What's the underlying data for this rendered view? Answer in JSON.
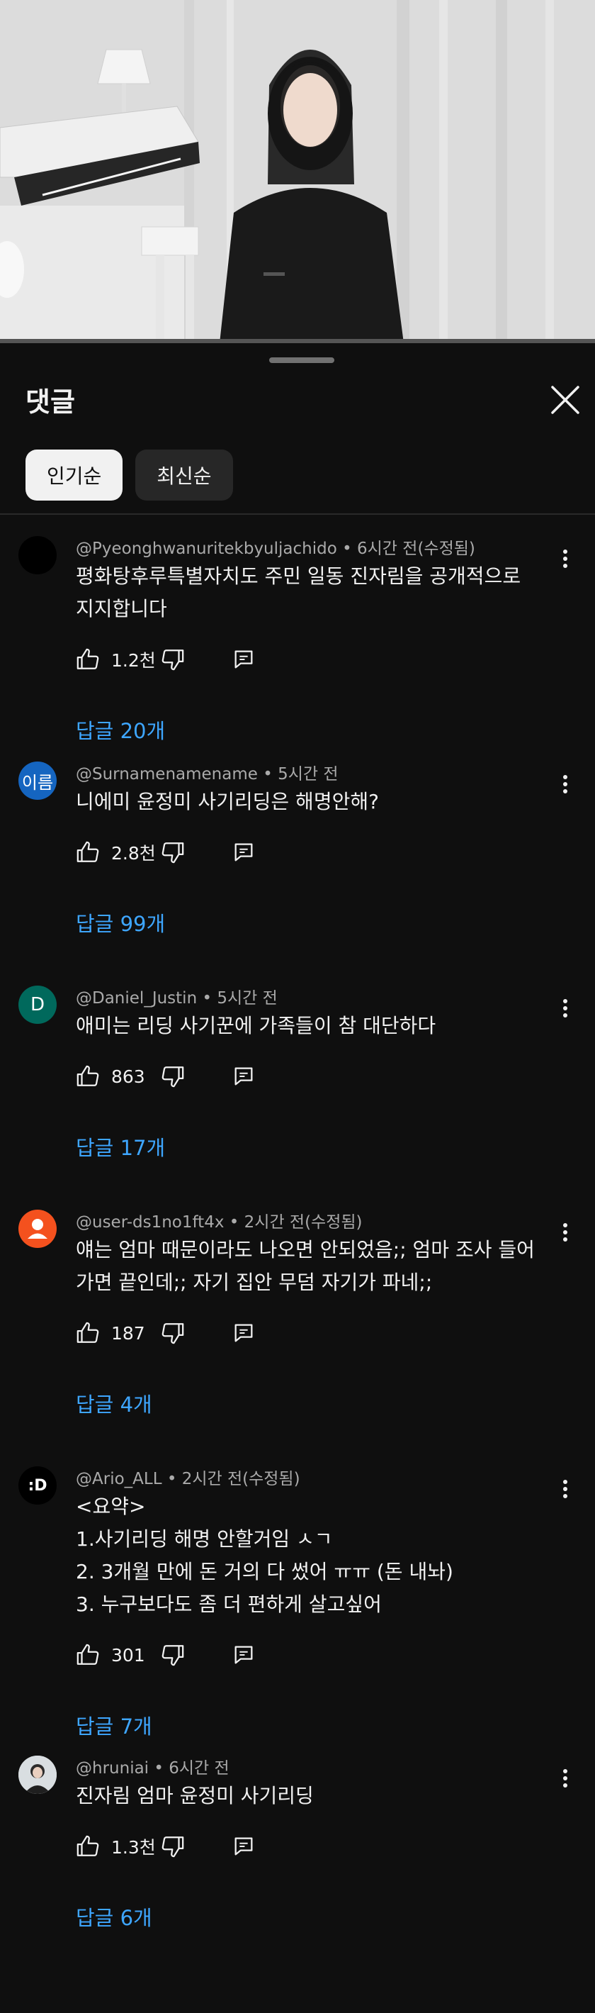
{
  "sheet": {
    "title": "댓글",
    "close_icon": "close-icon"
  },
  "sort_chips": [
    {
      "label": "인기순",
      "active": true
    },
    {
      "label": "최신순",
      "active": false
    }
  ],
  "colors": {
    "background": "#0f0f0f",
    "text_primary": "#f1f1f1",
    "text_secondary": "#aaaaaa",
    "link_blue": "#3ea6ff",
    "chip_bg": "#272727"
  },
  "comments": [
    {
      "author": "@Pyeonghwanuritekbyuljachido",
      "time": "6시간 전(수정됨)",
      "text": "평화탕후루특별자치도 주민 일동 진자림을 공개적으로 지지합니다",
      "likes": "1.2천",
      "replies": "답글 20개",
      "avatar_text": "",
      "avatar_color": "#000000"
    },
    {
      "author": "@Surnamenamename",
      "time": "5시간 전",
      "text": "니에미 윤정미 사기리딩은 해명안해?",
      "likes": "2.8천",
      "replies": "답글 99개",
      "avatar_text": "이름",
      "avatar_color": "#1565c0"
    },
    {
      "author": "@Daniel_Justin",
      "time": "5시간 전",
      "text": "애미는 리딩 사기꾼에 가족들이 참 대단하다",
      "likes": "863",
      "replies": "답글 17개",
      "avatar_text": "D",
      "avatar_color": "#00695c"
    },
    {
      "author": "@user-ds1no1ft4x",
      "time": "2시간 전(수정됨)",
      "text": "얘는 엄마 때문이라도 나오면 안되었음;;  엄마 조사 들어가면 끝인데;; 자기  집안 무덤 자기가 파네;;",
      "likes": "187",
      "replies": "답글 4개",
      "avatar_text": "",
      "avatar_color": "#f4511e",
      "avatar_icon": "person-icon"
    },
    {
      "author": "@Ario_ALL",
      "time": "2시간 전(수정됨)",
      "text_lines": [
        "<요약>",
        "1.사기리딩 해명 안할거임 ㅅㄱ",
        "2. 3개월 만에 돈 거의 다 썼어 ㅠㅠ (돈 내놔)",
        "3. 누구보다도 좀 더 편하게 살고싶어"
      ],
      "likes": "301",
      "replies": "답글 7개",
      "avatar_text": ":D",
      "avatar_color": "#000000"
    },
    {
      "author": "@hruniai",
      "time": "6시간 전",
      "text": "진자림 엄마 윤정미 사기리딩",
      "likes": "1.3천",
      "replies": "답글 6개",
      "avatar_text": "",
      "avatar_color": "#cfd8dc",
      "avatar_icon": "profile-photo"
    }
  ],
  "icons": {
    "like": "thumbs-up-icon",
    "dislike": "thumbs-down-icon",
    "reply": "reply-icon",
    "more": "more-vert-icon"
  }
}
